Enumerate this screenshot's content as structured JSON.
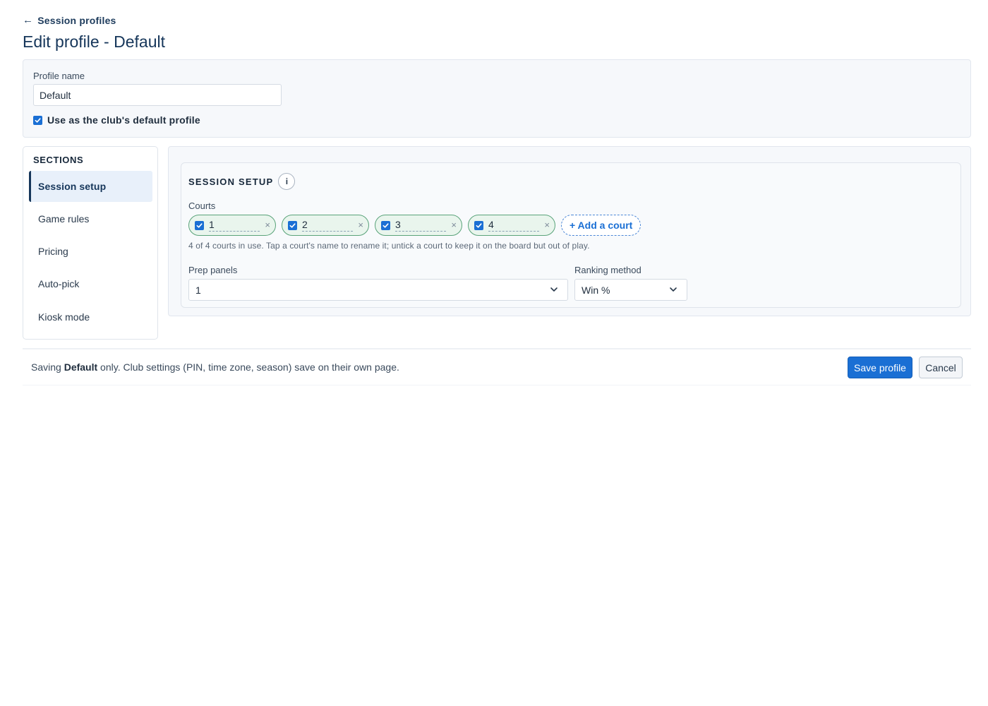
{
  "back_link": {
    "arrow": "←",
    "label": "Session profiles"
  },
  "page_title": "Edit profile - Default",
  "profile": {
    "name_label": "Profile name",
    "name_value": "Default",
    "default_checked": true,
    "default_label": "Use as the club's default profile"
  },
  "sections": {
    "title": "SECTIONS",
    "items": [
      {
        "label": "Session setup",
        "active": true
      },
      {
        "label": "Game rules",
        "active": false
      },
      {
        "label": "Pricing",
        "active": false
      },
      {
        "label": "Auto-pick",
        "active": false
      },
      {
        "label": "Kiosk mode",
        "active": false
      }
    ]
  },
  "session_setup": {
    "title": "SESSION SETUP",
    "info_icon": "i",
    "courts_label": "Courts",
    "courts": [
      {
        "name": "1",
        "checked": true,
        "remove": "×"
      },
      {
        "name": "2",
        "checked": true,
        "remove": "×"
      },
      {
        "name": "3",
        "checked": true,
        "remove": "×"
      },
      {
        "name": "4",
        "checked": true,
        "remove": "×"
      }
    ],
    "add_court_label": "+ Add a court",
    "courts_hint": "4 of 4 courts in use. Tap a court's name to rename it; untick a court to keep it on the board but out of play.",
    "prep_panels_label": "Prep panels",
    "prep_panels_value": "1",
    "ranking_label": "Ranking method",
    "ranking_value": "Win %"
  },
  "footer": {
    "note_prefix": "Saving ",
    "note_bold": "Default",
    "note_suffix": " only. Club settings (PIN, time zone, season) save on their own page.",
    "save_label": "Save profile",
    "cancel_label": "Cancel"
  },
  "colors": {
    "primary": "#1a6fd4",
    "title": "#16365a",
    "court_chip_bg": "#e9f5ed",
    "court_chip_border": "#5aa37a"
  },
  "icons": {
    "checkbox": "checkmark-icon",
    "select": "chevron-down-icon",
    "back": "arrow-left-icon",
    "remove": "close-icon"
  }
}
